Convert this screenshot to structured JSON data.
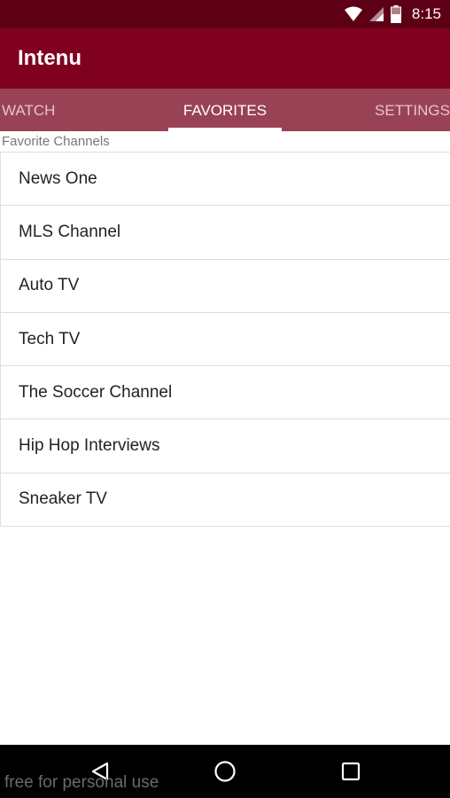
{
  "status_bar": {
    "time": "8:15",
    "icons": [
      "wifi-icon",
      "cell-signal-icon",
      "battery-icon"
    ]
  },
  "app_bar": {
    "title": "Intenu",
    "color": "#80001f"
  },
  "tabs": [
    {
      "label": "WATCH",
      "active": false
    },
    {
      "label": "FAVORITES",
      "active": true
    },
    {
      "label": "SETTINGS",
      "active": false
    }
  ],
  "favorites": {
    "header": "Favorite Channels",
    "channels": [
      {
        "name": "News One"
      },
      {
        "name": "MLS Channel"
      },
      {
        "name": "Auto TV"
      },
      {
        "name": "Tech TV"
      },
      {
        "name": "The Soccer Channel"
      },
      {
        "name": "Hip Hop Interviews"
      },
      {
        "name": "Sneaker TV"
      }
    ]
  },
  "nav_bar": {
    "buttons": [
      "back-icon",
      "home-icon",
      "recents-icon"
    ]
  },
  "watermark": "free for personal use",
  "colors": {
    "status_bar": "#5e0015",
    "app_bar": "#80001f",
    "tab_bar": "#9a4255",
    "accent": "#ffffff"
  }
}
